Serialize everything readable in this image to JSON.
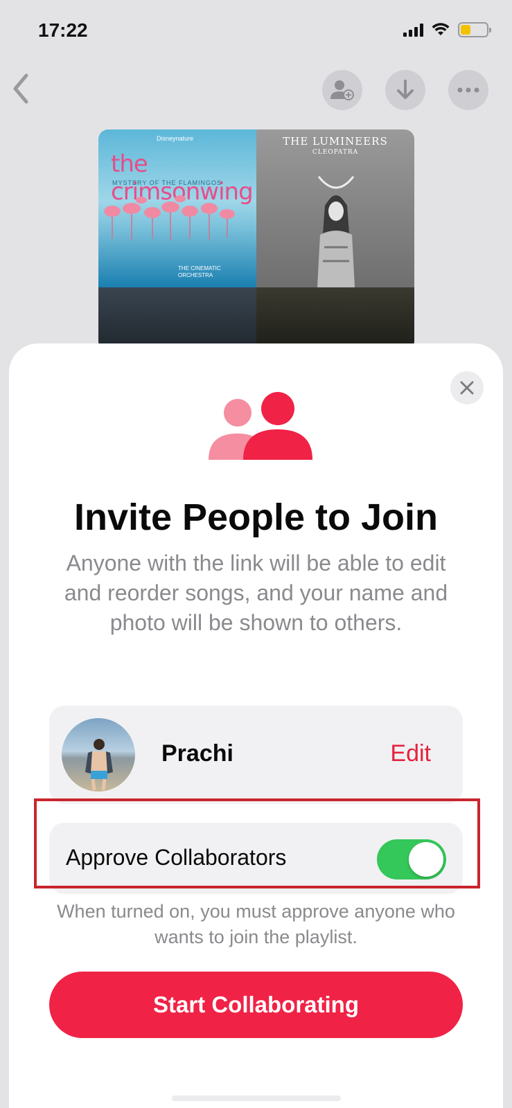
{
  "status_bar": {
    "time": "17:22"
  },
  "artwork": {
    "album1": {
      "brand": "Disneynature",
      "title": "the crimsonwing",
      "subtitle": "MYSTERY OF THE FLAMINGOS",
      "credit": "THE CINEMATIC ORCHESTRA"
    },
    "album2": {
      "title": "THE LUMINEERS",
      "subtitle": "CLEOPATRA"
    }
  },
  "sheet": {
    "title": "Invite People to Join",
    "description": "Anyone with the link will be able to edit and reorder songs, and your name and photo will be shown to others.",
    "profile": {
      "name": "Prachi",
      "edit_label": "Edit"
    },
    "approve": {
      "label": "Approve Collaborators",
      "enabled": true
    },
    "hint": "When turned on, you must approve anyone who wants to join the playlist.",
    "start_button": "Start Collaborating"
  },
  "colors": {
    "accent": "#f02246",
    "toggle_on": "#34c759",
    "highlight": "#c9252e"
  }
}
